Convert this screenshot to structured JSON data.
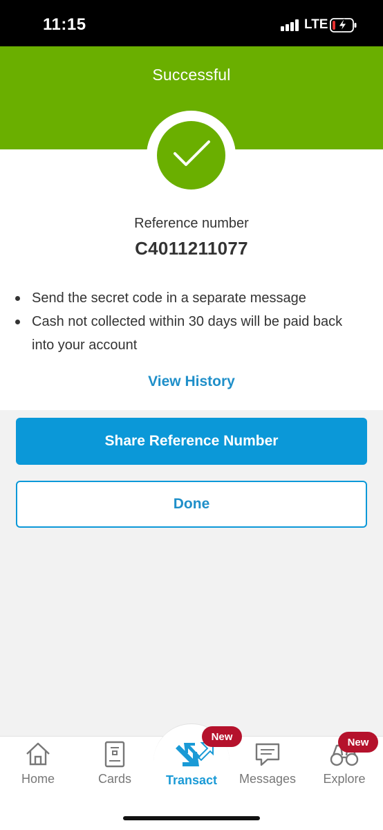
{
  "status_bar": {
    "time": "11:15",
    "network": "LTE",
    "signal_icon": "signal-bars-icon",
    "battery_icon": "battery-charging-icon"
  },
  "header": {
    "title": "Successful",
    "color": "#6aaf00",
    "status_icon": "checkmark-icon"
  },
  "confirmation": {
    "reference_label": "Reference number",
    "reference_number": "C4011211077",
    "notes": [
      "Send the secret code in a separate message",
      "Cash not collected within 30 days will be paid back into your account"
    ],
    "view_history_label": "View History"
  },
  "actions": {
    "share_label": "Share Reference Number",
    "done_label": "Done",
    "accent_color": "#0b98d8"
  },
  "bottom_nav": {
    "items": [
      {
        "label": "Home",
        "icon": "home-icon",
        "active": false
      },
      {
        "label": "Cards",
        "icon": "cards-icon",
        "active": false
      },
      {
        "label": "Transact",
        "icon": "transact-icon",
        "active": true,
        "badge": "New"
      },
      {
        "label": "Messages",
        "icon": "messages-icon",
        "active": false
      },
      {
        "label": "Explore",
        "icon": "binoculars-icon",
        "active": false,
        "badge": "New"
      }
    ],
    "badge_color": "#b5122c"
  }
}
